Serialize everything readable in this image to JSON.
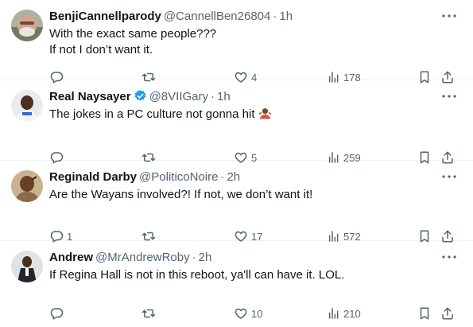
{
  "tweets": [
    {
      "name": "BenjiCannellparody",
      "handle": "@CannellBen26804",
      "time": "1h",
      "verified": false,
      "lines": [
        "With the exact same people???",
        "If not I don’t want it."
      ],
      "reply_count": "",
      "retweet_count": "",
      "like_count": "4",
      "view_count": "178"
    },
    {
      "name": "Real Naysayer",
      "handle": "@8VIIGary",
      "time": "1h",
      "verified": true,
      "lines": [
        "The jokes in a PC culture not gonna hit"
      ],
      "emoji": "person-shrugging-emoji",
      "reply_count": "",
      "retweet_count": "",
      "like_count": "5",
      "view_count": "259"
    },
    {
      "name": "Reginald Darby",
      "handle": "@PoliticoNoire",
      "time": "2h",
      "verified": false,
      "lines": [
        "Are the Wayans involved?! If not, we don’t want it!"
      ],
      "reply_count": "1",
      "retweet_count": "",
      "like_count": "17",
      "view_count": "572"
    },
    {
      "name": "Andrew",
      "handle": "@MrAndrewRoby",
      "time": "2h",
      "verified": false,
      "lines": [
        "If Regina Hall is not in this reboot, ya'll can have it. LOL."
      ],
      "reply_count": "",
      "retweet_count": "",
      "like_count": "10",
      "view_count": "210"
    }
  ],
  "ui": {
    "dot": "·",
    "icon_color": "#536471",
    "verified_color": "#1d9bf0"
  }
}
